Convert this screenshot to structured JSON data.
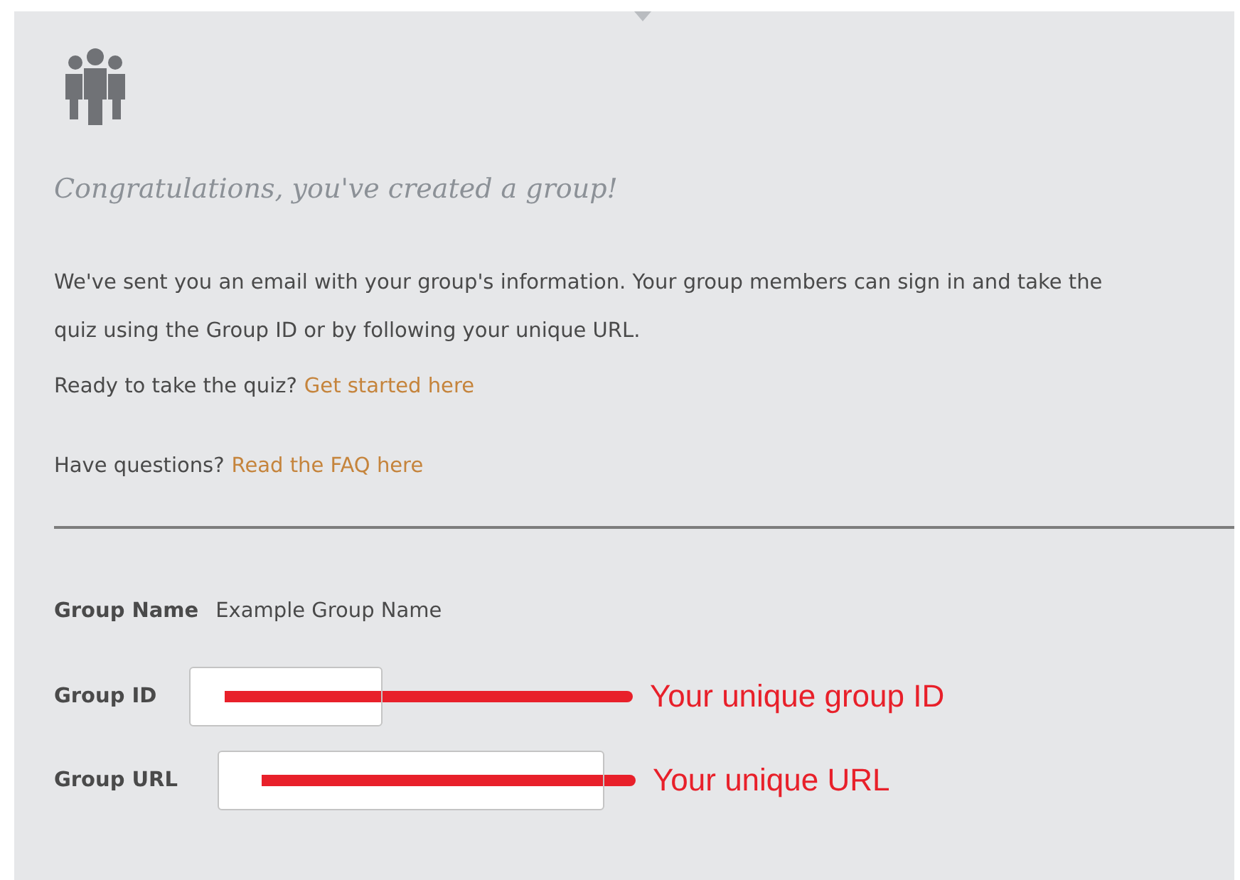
{
  "heading": "Congratulations, you've created a group!",
  "intro": "We've sent you an email with your group's information. Your group members can sign in and take the quiz using the Group ID or by following your unique URL.",
  "prompts": [
    {
      "text": "Ready to take the quiz?",
      "link": "Get started here"
    },
    {
      "text": "Have questions?",
      "link": "Read the FAQ here"
    }
  ],
  "group_name": {
    "label": "Group Name",
    "value": "Example Group Name"
  },
  "fields": [
    {
      "label": "Group ID",
      "annotation": "Your unique group ID"
    },
    {
      "label": "Group URL",
      "annotation": "Your unique URL"
    }
  ]
}
